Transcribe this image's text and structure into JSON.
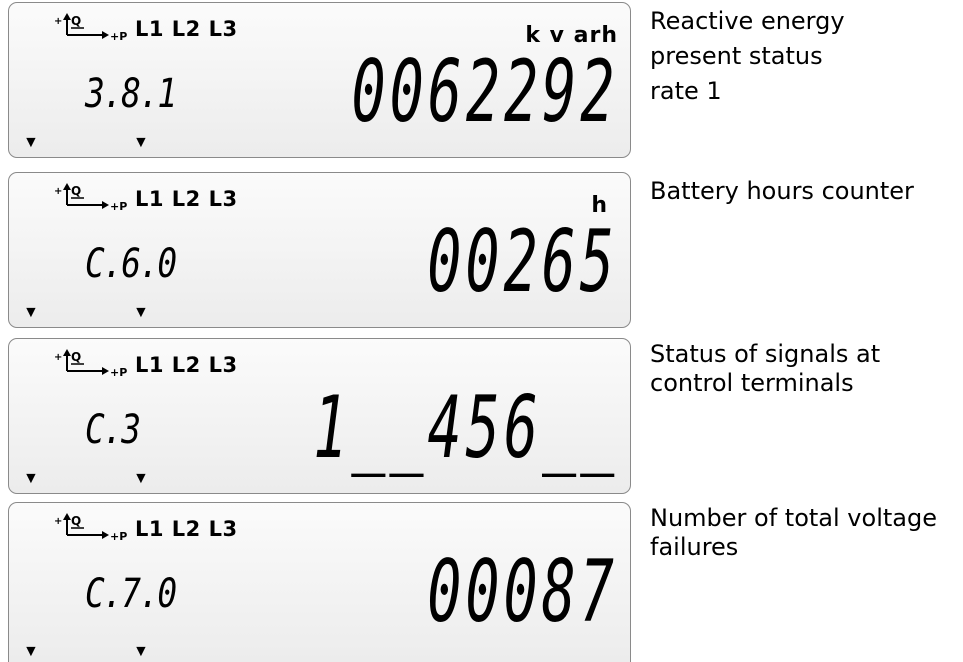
{
  "icons": {
    "phase_diagram": "reactive-active-power-axes-icon",
    "arrow": "down-triangle-icon"
  },
  "phase_icon_labels": {
    "plus_q": "+",
    "q": "Q",
    "plus_p": "+P"
  },
  "phases_label": "L1 L2 L3",
  "arrow_glyph": "▼",
  "displays": [
    {
      "code": "3.8.1",
      "value": "0062292",
      "unit": "k v arh",
      "description": [
        "Reactive energy",
        "present status",
        "rate 1"
      ]
    },
    {
      "code": "C.6.0",
      "value": "00265",
      "unit": "h",
      "description": [
        "Battery hours counter"
      ]
    },
    {
      "code": "C.3",
      "value": "1__456__",
      "unit": "",
      "description": [
        "Status of signals at",
        "control terminals"
      ]
    },
    {
      "code": "C.7.0",
      "value": "00087",
      "unit": "",
      "description": [
        "Number of total voltage",
        "failures"
      ]
    }
  ]
}
